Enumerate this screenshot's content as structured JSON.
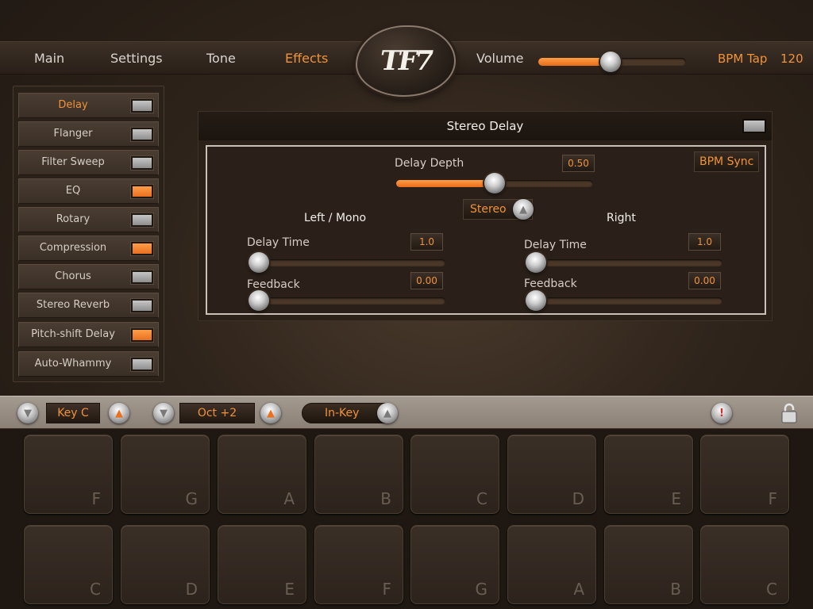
{
  "nav": {
    "items": [
      {
        "label": "Main"
      },
      {
        "label": "Settings"
      },
      {
        "label": "Tone"
      },
      {
        "label": "Effects",
        "active": true
      }
    ],
    "logo_text": "TF7",
    "volume_label": "Volume",
    "volume_level": 0.49,
    "bpm_tap_label": "BPM Tap",
    "bpm_value": "120"
  },
  "effects": {
    "items": [
      {
        "label": "Delay",
        "on": false,
        "selected": true
      },
      {
        "label": "Flanger",
        "on": false
      },
      {
        "label": "Filter Sweep",
        "on": false
      },
      {
        "label": "EQ",
        "on": true
      },
      {
        "label": "Rotary",
        "on": false
      },
      {
        "label": "Compression",
        "on": true
      },
      {
        "label": "Chorus",
        "on": false
      },
      {
        "label": "Stereo Reverb",
        "on": false
      },
      {
        "label": "Pitch-shift Delay",
        "on": true
      },
      {
        "label": "Auto-Whammy",
        "on": false
      }
    ]
  },
  "panel": {
    "title": "Stereo Delay",
    "enabled": false,
    "delay_depth_label": "Delay Depth",
    "delay_depth_value": "0.50",
    "delay_depth_level": 0.5,
    "bpm_sync_label": "BPM Sync",
    "stereo_label": "Stereo",
    "left": {
      "heading": "Left / Mono",
      "delay_time_label": "Delay Time",
      "delay_time_value": "1.0",
      "delay_time_level": 0.0,
      "feedback_label": "Feedback",
      "feedback_value": "0.00",
      "feedback_level": 0.0
    },
    "right": {
      "heading": "Right",
      "delay_time_label": "Delay Time",
      "delay_time_value": "1.0",
      "delay_time_level": 0.0,
      "feedback_label": "Feedback",
      "feedback_value": "0.00",
      "feedback_level": 0.0
    }
  },
  "keybar": {
    "key_label": "Key C",
    "octave_label": "Oct +2",
    "inkey_label": "In-Key",
    "alert_glyph": "!"
  },
  "pads": {
    "row1": [
      "F",
      "G",
      "A",
      "B",
      "C",
      "D",
      "E",
      "F"
    ],
    "row2": [
      "C",
      "D",
      "E",
      "F",
      "G",
      "A",
      "B",
      "C"
    ]
  },
  "colors": {
    "accent": "#f0923a",
    "toggle_on": "#f47e2b",
    "toggle_off": "#b8b8b8"
  }
}
